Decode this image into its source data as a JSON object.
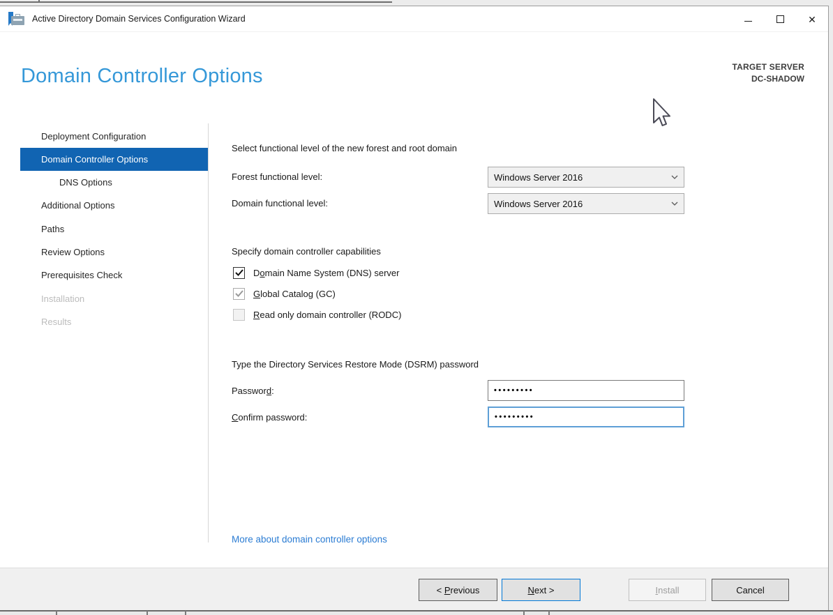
{
  "colors": {
    "accent_selected": "#1164b2",
    "heading_blue": "#3598d8",
    "link_blue": "#2b7cd3",
    "default_button_border": "#0078d7"
  },
  "icons": {
    "app": "server-manager-toolbox-icon",
    "minimize": "minimize-icon",
    "maximize": "maximize-icon",
    "close": "close-icon",
    "close_glyph": "✕",
    "dropdown": "chevron-down-icon",
    "checkbox_checked": "checkmark-icon",
    "pointer": "mouse-arrow-cursor"
  },
  "window": {
    "title": "Active Directory Domain Services Configuration Wizard"
  },
  "header": {
    "page_title": "Domain Controller Options",
    "target_server_label": "TARGET SERVER",
    "target_server_name": "DC-SHADOW"
  },
  "sidebar": {
    "items": [
      {
        "label": "Deployment Configuration",
        "state": "normal",
        "indent": 0
      },
      {
        "label": "Domain Controller Options",
        "state": "selected",
        "indent": 0
      },
      {
        "label": "DNS Options",
        "state": "normal",
        "indent": 1
      },
      {
        "label": "Additional Options",
        "state": "normal",
        "indent": 0
      },
      {
        "label": "Paths",
        "state": "normal",
        "indent": 0
      },
      {
        "label": "Review Options",
        "state": "normal",
        "indent": 0
      },
      {
        "label": "Prerequisites Check",
        "state": "normal",
        "indent": 0
      },
      {
        "label": "Installation",
        "state": "disabled",
        "indent": 0
      },
      {
        "label": "Results",
        "state": "disabled",
        "indent": 0
      }
    ]
  },
  "main": {
    "functional": {
      "heading": "Select functional level of the new forest and root domain",
      "forest_label": "Forest functional level:",
      "forest_value": "Windows Server 2016",
      "domain_label": "Domain functional level:",
      "domain_value": "Windows Server 2016"
    },
    "capabilities": {
      "heading": "Specify domain controller capabilities",
      "items": [
        {
          "pre": "D",
          "accel": "o",
          "post": "main Name System (DNS) server",
          "checked": true,
          "enabled": true
        },
        {
          "pre": "",
          "accel": "G",
          "post": "lobal Catalog (GC)",
          "checked": true,
          "enabled": false
        },
        {
          "pre": "",
          "accel": "R",
          "post": "ead only domain controller (RODC)",
          "checked": false,
          "enabled": false
        }
      ]
    },
    "dsrm": {
      "heading": "Type the Directory Services Restore Mode (DSRM) password",
      "password_label_pre": "Passwor",
      "password_label_accel": "d",
      "password_label_post": ":",
      "password_value_masked": "•••••••••",
      "confirm_label_pre": "",
      "confirm_label_accel": "C",
      "confirm_label_post": "onfirm password:",
      "confirm_value_masked": "•••••••••"
    },
    "link_text": "More about domain controller options"
  },
  "footer": {
    "previous": {
      "pre": "< ",
      "accel": "P",
      "post": "revious"
    },
    "next": {
      "pre": "",
      "accel": "N",
      "post": "ext >"
    },
    "install": {
      "pre": "",
      "accel": "I",
      "post": "nstall"
    },
    "cancel_label": "Cancel"
  }
}
